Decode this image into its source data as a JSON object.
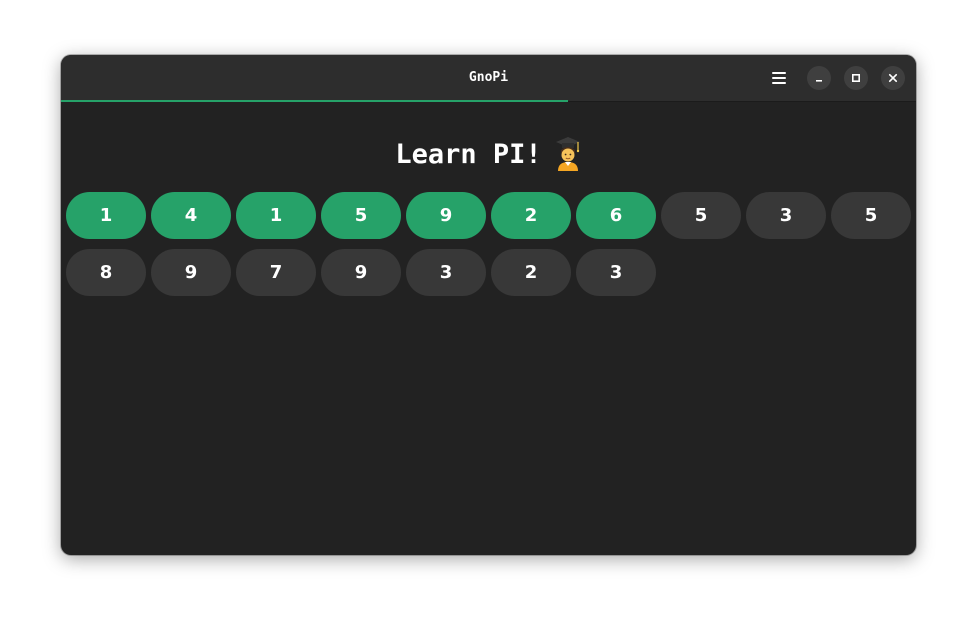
{
  "window": {
    "title": "GnoPi",
    "progress_fraction": 0.593
  },
  "header": {
    "heading": "Learn PI!",
    "heading_icon": "graduate-emoji"
  },
  "titlebar_buttons": {
    "menu_icon": "hamburger-menu-icon",
    "minimize_icon": "minimize-icon",
    "maximize_icon": "maximize-icon",
    "close_icon": "close-icon"
  },
  "colors": {
    "accent": "#26a269",
    "pending": "#383838",
    "background": "#222222",
    "titlebar": "#2d2d2d"
  },
  "digits": [
    {
      "value": "1",
      "done": true
    },
    {
      "value": "4",
      "done": true
    },
    {
      "value": "1",
      "done": true
    },
    {
      "value": "5",
      "done": true
    },
    {
      "value": "9",
      "done": true
    },
    {
      "value": "2",
      "done": true
    },
    {
      "value": "6",
      "done": true
    },
    {
      "value": "5",
      "done": false
    },
    {
      "value": "3",
      "done": false
    },
    {
      "value": "5",
      "done": false
    },
    {
      "value": "8",
      "done": false
    },
    {
      "value": "9",
      "done": false
    },
    {
      "value": "7",
      "done": false
    },
    {
      "value": "9",
      "done": false
    },
    {
      "value": "3",
      "done": false
    },
    {
      "value": "2",
      "done": false
    },
    {
      "value": "3",
      "done": false
    }
  ]
}
